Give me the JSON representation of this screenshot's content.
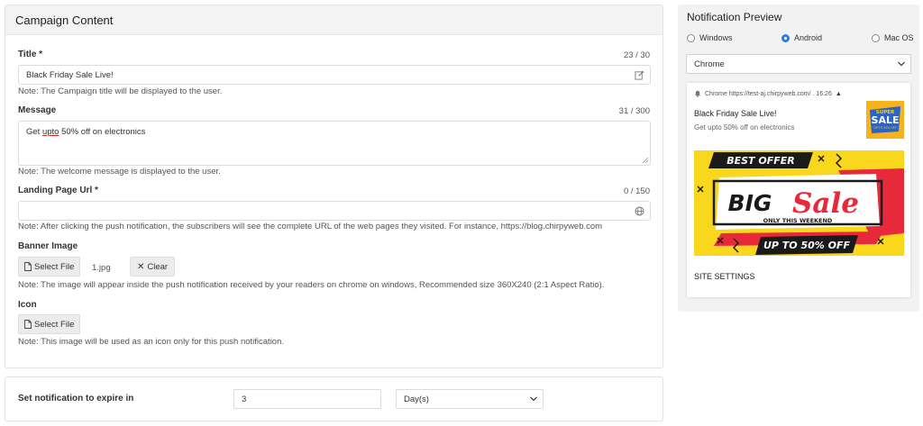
{
  "campaign": {
    "header": "Campaign Content",
    "title_field": {
      "label": "Title *",
      "counter": "23 / 30",
      "value": "Black Friday Sale Live!",
      "note": "Note: The Campaign title will be displayed to the user."
    },
    "message_field": {
      "label": "Message",
      "counter": "31 / 300",
      "value_pre": "Get ",
      "value_underlined": "upto",
      "value_post": " 50% off on electronics",
      "note": "Note: The welcome message is displayed to the user."
    },
    "landing_field": {
      "label": "Landing Page Url *",
      "counter": "0 / 150",
      "value": "",
      "note": "Note: After clicking the push notification, the subscribers will see the complete URL of the web pages they visited. For instance, https://blog.chirpyweb.com"
    },
    "banner_field": {
      "label": "Banner Image",
      "select_label": "Select File",
      "filename": "1.jpg",
      "clear_label": "Clear",
      "note": "Note: The image will appear inside the push notification received by your readers on chrome on windows, Recommended size 360X240 (2:1 Aspect Ratio)."
    },
    "icon_field": {
      "label": "Icon",
      "select_label": "Select File",
      "note": "Note: This image will be used as an icon only for this push notification."
    }
  },
  "expire": {
    "label": "Set notification to expire in",
    "value": "3",
    "unit": "Day(s)"
  },
  "preview": {
    "title": "Notification Preview",
    "os_options": [
      "Windows",
      "Android",
      "Mac OS"
    ],
    "os_selected": "Android",
    "browser": "Chrome",
    "notification": {
      "header": "Chrome https://test-aj.chirpyweb.com/ . 16:26",
      "title": "Black Friday Sale Live!",
      "message": "Get upto 50% off on electronics",
      "icon_text": {
        "line1": "SUPER",
        "line2": "SALE",
        "line3": "UP TO 50% OFF"
      },
      "banner_text": {
        "top": "BEST OFFER",
        "big": "BIG",
        "sale": "Sale",
        "weekend": "ONLY THIS WEEKEND",
        "bottom": "UP TO 50% OFF"
      },
      "settings": "SITE SETTINGS"
    }
  },
  "colors": {
    "accent": "#2f7bdc",
    "banner_yellow": "#f9d71c",
    "banner_red": "#e8283b",
    "banner_dark": "#1a1a1a"
  }
}
